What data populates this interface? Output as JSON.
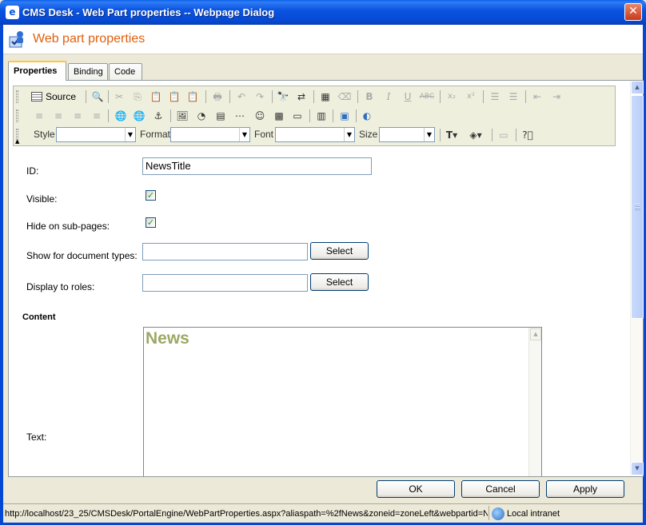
{
  "window": {
    "title": "CMS Desk - Web Part properties -- Webpage Dialog",
    "close_label": "✕"
  },
  "header": {
    "title": "Web part properties",
    "icon": "webpart-properties-icon"
  },
  "tabs": [
    {
      "label": "Properties",
      "active": true
    },
    {
      "label": "Binding",
      "active": false
    },
    {
      "label": "Code",
      "active": false
    }
  ],
  "toolbar": {
    "source_label": "Source",
    "style_label": "Style",
    "style_value": "",
    "format_label": "Format",
    "format_value": "",
    "font_label": "Font",
    "font_value": "",
    "size_label": "Size",
    "size_value": ""
  },
  "form": {
    "id_label": "ID:",
    "id_value": "NewsTitle",
    "visible_label": "Visible:",
    "visible_checked": true,
    "hide_label": "Hide on sub-pages:",
    "hide_checked": true,
    "doctypes_label": "Show for document types:",
    "doctypes_value": "",
    "roles_label": "Display to roles:",
    "roles_value": "",
    "select_label": "Select",
    "content_heading": "Content",
    "text_label": "Text:",
    "text_heading": "News"
  },
  "footer": {
    "ok_label": "OK",
    "cancel_label": "Cancel",
    "apply_label": "Apply"
  },
  "status": {
    "url": "http://localhost/23_25/CMSDesk/PortalEngine/WebPartProperties.aspx?aliaspath=%2fNews&zoneid=zoneLeft&webpartid=N",
    "zone": "Local intranet"
  },
  "colors": {
    "header_title": "#E0600E",
    "content_heading": "#9CA864",
    "titlebar": "#0548D4"
  }
}
